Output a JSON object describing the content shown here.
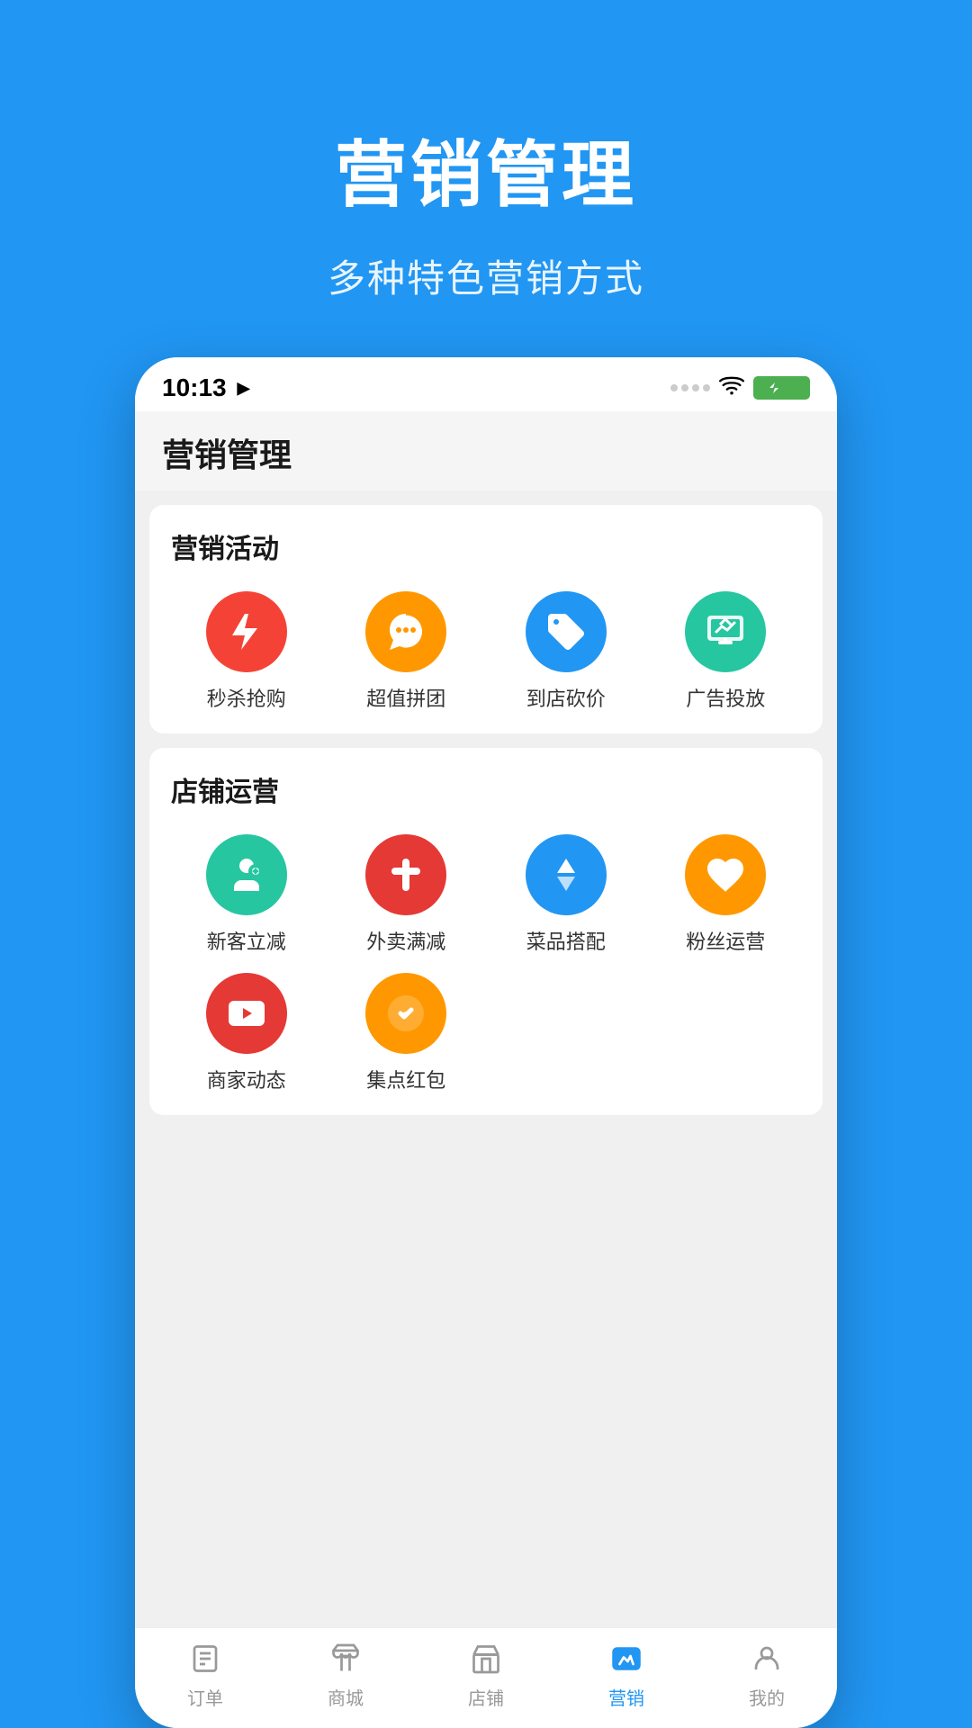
{
  "background_color": "#2196F3",
  "header": {
    "main_title": "营销管理",
    "subtitle": "多种特色营销方式"
  },
  "status_bar": {
    "time": "10:13",
    "arrow": "➤"
  },
  "app_title": "营销管理",
  "sections": [
    {
      "id": "marketing_activities",
      "title": "营销活动",
      "items": [
        {
          "id": "flash_sale",
          "label": "秒杀抢购",
          "icon_color": "#F44336",
          "icon_type": "lightning"
        },
        {
          "id": "group_buy",
          "label": "超值拼团",
          "icon_color": "#FF9800",
          "icon_type": "puzzle"
        },
        {
          "id": "store_discount",
          "label": "到店砍价",
          "icon_color": "#2196F3",
          "icon_type": "tag"
        },
        {
          "id": "advertising",
          "label": "广告投放",
          "icon_color": "#26C6A0",
          "icon_type": "chart"
        }
      ]
    },
    {
      "id": "store_operations",
      "title": "店铺运营",
      "items": [
        {
          "id": "new_customer",
          "label": "新客立减",
          "icon_color": "#26C6A0",
          "icon_type": "person"
        },
        {
          "id": "delivery_discount",
          "label": "外卖满减",
          "icon_color": "#E53935",
          "icon_type": "bar_chart"
        },
        {
          "id": "food_combo",
          "label": "菜品搭配",
          "icon_color": "#2196F3",
          "icon_type": "thumb_up"
        },
        {
          "id": "fan_ops",
          "label": "粉丝运营",
          "icon_color": "#FF9800",
          "icon_type": "heart"
        },
        {
          "id": "merchant_updates",
          "label": "商家动态",
          "icon_color": "#E53935",
          "icon_type": "video"
        },
        {
          "id": "points_redpacket",
          "label": "集点红包",
          "icon_color": "#FF9800",
          "icon_type": "check_circle"
        },
        {
          "id": "empty1",
          "label": "",
          "icon_color": "transparent",
          "icon_type": "none"
        },
        {
          "id": "empty2",
          "label": "",
          "icon_color": "transparent",
          "icon_type": "none"
        }
      ]
    }
  ],
  "bottom_nav": [
    {
      "id": "orders",
      "label": "订单",
      "icon": "list",
      "active": false
    },
    {
      "id": "shop",
      "label": "商城",
      "icon": "bag",
      "active": false
    },
    {
      "id": "store",
      "label": "店铺",
      "icon": "store",
      "active": false
    },
    {
      "id": "marketing",
      "label": "营销",
      "icon": "trending",
      "active": true
    },
    {
      "id": "mine",
      "label": "我的",
      "icon": "person",
      "active": false
    }
  ]
}
